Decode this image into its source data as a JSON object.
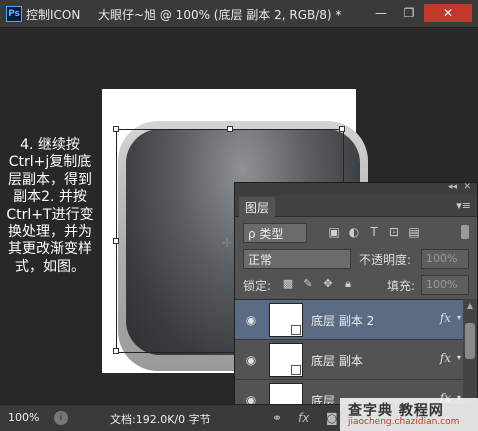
{
  "titlebar": {
    "logo": "Ps",
    "app_name": "控制ICON",
    "doc_title": "大眼仔~旭 @ 100% (底层 副本 2, RGB/8) *",
    "minimize": "—",
    "maximize": "❐",
    "close": "✕"
  },
  "instructions": {
    "text": "4. 继续按Ctrl+j复制底层副本，得到副本2. 并按Ctrl+T进行变换处理，并为其更改渐变样式，如图。"
  },
  "layers_panel": {
    "collapse": "◂◂",
    "close": "✕",
    "tab_label": "图层",
    "menu": "▾≡",
    "filter": {
      "kind_label": "ρ 类型",
      "icons": [
        "image-filter-icon",
        "adjustment-filter-icon",
        "type-filter-icon",
        "shape-filter-icon",
        "smart-object-filter-icon"
      ]
    },
    "blend_mode": "正常",
    "opacity_label": "不透明度:",
    "opacity_value": "100%",
    "lock_label": "锁定:",
    "fill_label": "填充:",
    "fill_value": "100%",
    "layers": [
      {
        "name": "底层 副本 2",
        "selected": true,
        "fx": "fx"
      },
      {
        "name": "底层 副本",
        "selected": false,
        "fx": "fx"
      },
      {
        "name": "底层",
        "selected": false,
        "fx": "fx"
      }
    ],
    "fx_arrow": "▾",
    "scroll_up": "▲"
  },
  "statusbar": {
    "zoom": "100%",
    "doc_info": "文档:192.0K/0 字节"
  },
  "watermark": {
    "main": "查字典 教程网",
    "sub": "jiaocheng.chazidian.com"
  },
  "colors": {
    "titlebar_bg": "#3a3a3a",
    "canvas_bg": "#282828",
    "panel_bg": "#535353",
    "selected_layer": "#5a6b83",
    "close_button": "#c0392b"
  }
}
